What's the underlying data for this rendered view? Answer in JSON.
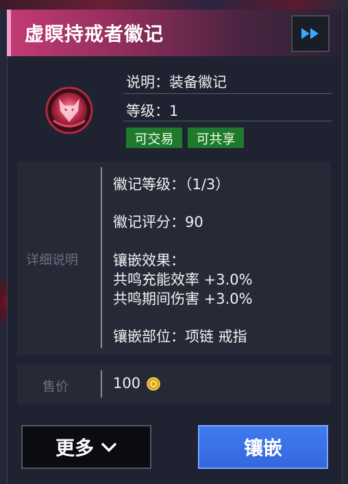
{
  "title": "虚瞑持戒者徽记",
  "info": {
    "description": "说明：装备徽记",
    "level": "等级：1"
  },
  "tags": [
    "可交易",
    "可共享"
  ],
  "details": {
    "label": "详细说明",
    "emblem_level": "徽记等级：（1/3）",
    "emblem_score": "徽记评分：90",
    "inlay_effect_title": "镶嵌效果：",
    "effect_1": "共鸣充能效率 +3.0%",
    "effect_2": "共鸣期间伤害 +3.0%",
    "inlay_slot": "镶嵌部位：项链 戒指"
  },
  "price": {
    "label": "售价",
    "value": "100"
  },
  "buttons": {
    "more": "更多",
    "inlay": "镶嵌"
  },
  "icons": {
    "fast_forward": "fast-forward-icon",
    "emblem": "fox-emblem-icon",
    "coin": "coin-icon",
    "chevron": "chevron-down-icon"
  },
  "colors": {
    "accent_pink": "#c23a74",
    "tag_green": "#1f7a2e",
    "button_blue": "#3f7bf0"
  }
}
